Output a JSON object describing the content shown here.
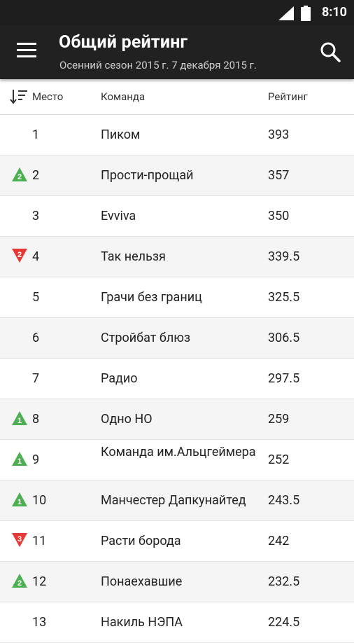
{
  "status": {
    "time": "8:10",
    "network": "3G"
  },
  "appbar": {
    "title": "Общий рейтинг",
    "subtitle": "Осенний сезон 2015 г. 7 декабря 2015 г."
  },
  "columns": {
    "place": "Место",
    "team": "Команда",
    "rating": "Рейтинг"
  },
  "colors": {
    "up": "#4caf50",
    "down": "#e53935",
    "bar": "#212121"
  },
  "rows": [
    {
      "place": "1",
      "team": "Пиком",
      "rating": "393",
      "change": null,
      "dir": null
    },
    {
      "place": "2",
      "team": "Прости-прощай",
      "rating": "357",
      "change": "2",
      "dir": "up"
    },
    {
      "place": "3",
      "team": "Evviva",
      "rating": "350",
      "change": null,
      "dir": null
    },
    {
      "place": "4",
      "team": "Так нельзя",
      "rating": "339.5",
      "change": "2",
      "dir": "down"
    },
    {
      "place": "5",
      "team": "Грачи без границ",
      "rating": "325.5",
      "change": null,
      "dir": null
    },
    {
      "place": "6",
      "team": "Стройбат блюз",
      "rating": "306.5",
      "change": null,
      "dir": null
    },
    {
      "place": "7",
      "team": "Радио",
      "rating": "297.5",
      "change": null,
      "dir": null
    },
    {
      "place": "8",
      "team": "Одно НО",
      "rating": "259",
      "change": "1",
      "dir": "up"
    },
    {
      "place": "9",
      "team": "Команда им.Альцгеймера",
      "rating": "252",
      "change": "1",
      "dir": "up",
      "tall": true
    },
    {
      "place": "10",
      "team": "Манчестер Дапкунайтед",
      "rating": "243.5",
      "change": "1",
      "dir": "up"
    },
    {
      "place": "11",
      "team": "Расти борода",
      "rating": "242",
      "change": "3",
      "dir": "down"
    },
    {
      "place": "12",
      "team": "Понаехавшие",
      "rating": "232.5",
      "change": "2",
      "dir": "up"
    },
    {
      "place": "13",
      "team": "Накиль НЭПА",
      "rating": "224.5",
      "change": null,
      "dir": null
    }
  ]
}
